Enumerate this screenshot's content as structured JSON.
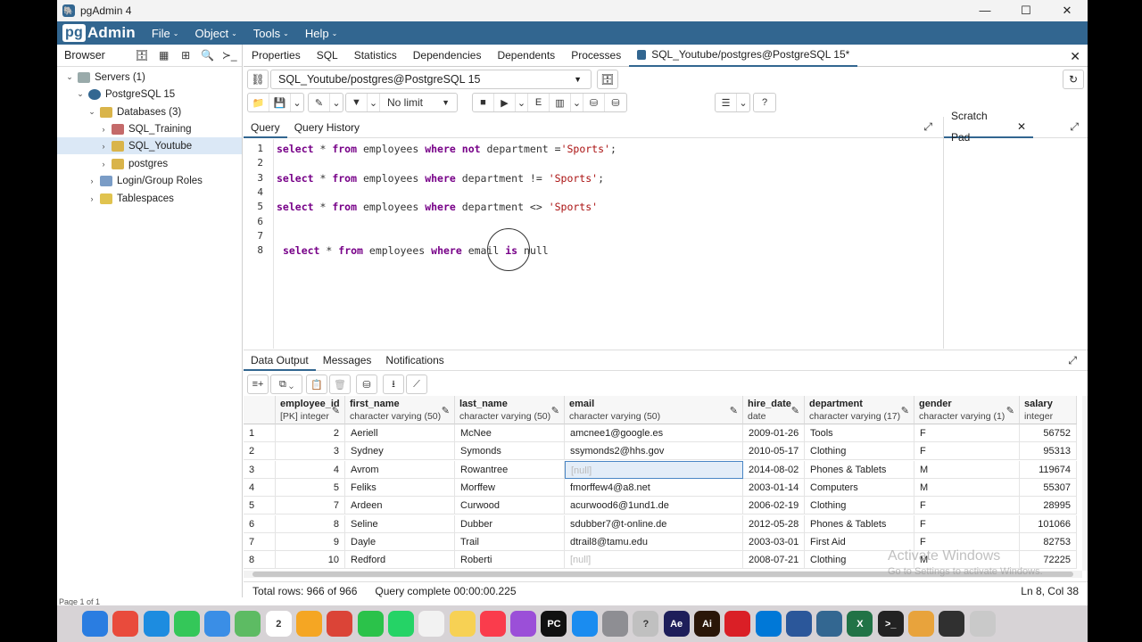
{
  "window": {
    "title": "pgAdmin 4",
    "btn_min": "—",
    "btn_max": "☐",
    "btn_close": "✕"
  },
  "menu": {
    "logo_pg": "pg",
    "logo_admin": "Admin",
    "items": [
      "File",
      "Object",
      "Tools",
      "Help"
    ]
  },
  "browser": {
    "title": "Browser",
    "tree": [
      {
        "label": "Servers (1)",
        "arrow": "⌄"
      },
      {
        "label": "PostgreSQL 15",
        "arrow": "⌄"
      },
      {
        "label": "Databases (3)",
        "arrow": "⌄"
      },
      {
        "label": "SQL_Training",
        "arrow": "›"
      },
      {
        "label": "SQL_Youtube",
        "arrow": "›"
      },
      {
        "label": "postgres",
        "arrow": "›"
      },
      {
        "label": "Login/Group Roles",
        "arrow": "›"
      },
      {
        "label": "Tablespaces",
        "arrow": "›"
      }
    ],
    "page_info": "Page 1 of 1"
  },
  "main_tabs": [
    "Properties",
    "SQL",
    "Statistics",
    "Dependencies",
    "Dependents",
    "Processes",
    "SQL_Youtube/postgres@PostgreSQL 15*"
  ],
  "connection": {
    "value": "SQL_Youtube/postgres@PostgreSQL 15"
  },
  "toolbar": {
    "limit": "No limit"
  },
  "query_tabs": [
    "Query",
    "Query History"
  ],
  "scratch": {
    "title": "Scratch Pad",
    "close": "✕"
  },
  "editor": {
    "line_numbers": [
      "1",
      "2",
      "3",
      "4",
      "5",
      "6",
      "7",
      "8"
    ],
    "lines": [
      [
        {
          "t": "select",
          "k": "kw"
        },
        {
          "t": " * ",
          "k": ""
        },
        {
          "t": "from",
          "k": "kw"
        },
        {
          "t": " employees ",
          "k": ""
        },
        {
          "t": "where",
          "k": "kw"
        },
        {
          "t": " ",
          "k": ""
        },
        {
          "t": "not",
          "k": "kw"
        },
        {
          "t": " department =",
          "k": ""
        },
        {
          "t": "'Sports'",
          "k": "str"
        },
        {
          "t": ";",
          "k": ""
        }
      ],
      [],
      [
        {
          "t": "select",
          "k": "kw"
        },
        {
          "t": " * ",
          "k": ""
        },
        {
          "t": "from",
          "k": "kw"
        },
        {
          "t": " employees ",
          "k": ""
        },
        {
          "t": "where",
          "k": "kw"
        },
        {
          "t": " department != ",
          "k": ""
        },
        {
          "t": "'Sports'",
          "k": "str"
        },
        {
          "t": ";",
          "k": ""
        }
      ],
      [],
      [
        {
          "t": "select",
          "k": "kw"
        },
        {
          "t": " * ",
          "k": ""
        },
        {
          "t": "from",
          "k": "kw"
        },
        {
          "t": " employees ",
          "k": ""
        },
        {
          "t": "where",
          "k": "kw"
        },
        {
          "t": " department <> ",
          "k": ""
        },
        {
          "t": "'Sports'",
          "k": "str"
        }
      ],
      [],
      [],
      [
        {
          "t": " ",
          "k": ""
        },
        {
          "t": "select",
          "k": "kw"
        },
        {
          "t": " * ",
          "k": ""
        },
        {
          "t": "from",
          "k": "kw"
        },
        {
          "t": " employees ",
          "k": ""
        },
        {
          "t": "where",
          "k": "kw"
        },
        {
          "t": " email ",
          "k": ""
        },
        {
          "t": "is",
          "k": "kw"
        },
        {
          "t": " null",
          "k": ""
        }
      ]
    ]
  },
  "output_tabs": [
    "Data Output",
    "Messages",
    "Notifications"
  ],
  "grid": {
    "columns": [
      {
        "name": "employee_id",
        "type": "[PK] integer"
      },
      {
        "name": "first_name",
        "type": "character varying (50)"
      },
      {
        "name": "last_name",
        "type": "character varying (50)"
      },
      {
        "name": "email",
        "type": "character varying (50)"
      },
      {
        "name": "hire_date",
        "type": "date"
      },
      {
        "name": "department",
        "type": "character varying (17)"
      },
      {
        "name": "gender",
        "type": "character varying (1)"
      },
      {
        "name": "salary",
        "type": "integer"
      }
    ],
    "rows": [
      [
        "1",
        "2",
        "Aeriell",
        "McNee",
        "amcnee1@google.es",
        "2009-01-26",
        "Tools",
        "F",
        "56752"
      ],
      [
        "2",
        "3",
        "Sydney",
        "Symonds",
        "ssymonds2@hhs.gov",
        "2010-05-17",
        "Clothing",
        "F",
        "95313"
      ],
      [
        "3",
        "4",
        "Avrom",
        "Rowantree",
        "[null]",
        "2014-08-02",
        "Phones & Tablets",
        "M",
        "119674"
      ],
      [
        "4",
        "5",
        "Feliks",
        "Morffew",
        "fmorffew4@a8.net",
        "2003-01-14",
        "Computers",
        "M",
        "55307"
      ],
      [
        "5",
        "7",
        "Ardeen",
        "Curwood",
        "acurwood6@1und1.de",
        "2006-02-19",
        "Clothing",
        "F",
        "28995"
      ],
      [
        "6",
        "8",
        "Seline",
        "Dubber",
        "sdubber7@t-online.de",
        "2012-05-28",
        "Phones & Tablets",
        "F",
        "101066"
      ],
      [
        "7",
        "9",
        "Dayle",
        "Trail",
        "dtrail8@tamu.edu",
        "2003-03-01",
        "First Aid",
        "F",
        "82753"
      ],
      [
        "8",
        "10",
        "Redford",
        "Roberti",
        "[null]",
        "2008-07-21",
        "Clothing",
        "M",
        "72225"
      ]
    ]
  },
  "status": {
    "rows": "Total rows: 966 of 966",
    "query": "Query complete 00:00:00.225",
    "position": "Ln 8, Col 38"
  },
  "watermark": {
    "line1": "Activate Windows",
    "line2": "Go to Settings to activate Windows."
  },
  "dock": [
    {
      "icon": "finder-icon",
      "color": "#2a7de1",
      "label": ""
    },
    {
      "icon": "launchpad-icon",
      "color": "#e94b3c",
      "label": ""
    },
    {
      "icon": "safari-icon",
      "color": "#1d8ce0",
      "label": ""
    },
    {
      "icon": "messages-icon",
      "color": "#34c759",
      "label": ""
    },
    {
      "icon": "mail-icon",
      "color": "#3a8ee6",
      "label": ""
    },
    {
      "icon": "maps-icon",
      "color": "#5dbb63",
      "label": ""
    },
    {
      "icon": "calendar-icon",
      "color": "#ffffff",
      "label": "2"
    },
    {
      "icon": "photos-icon",
      "color": "#f5a623",
      "label": ""
    },
    {
      "icon": "chrome-icon",
      "color": "#db4437",
      "label": ""
    },
    {
      "icon": "facetime-icon",
      "color": "#2bc24a",
      "label": ""
    },
    {
      "icon": "whatsapp-icon",
      "color": "#25d366",
      "label": ""
    },
    {
      "icon": "reminders-icon",
      "color": "#f2f2f2",
      "label": ""
    },
    {
      "icon": "notes-icon",
      "color": "#f7d154",
      "label": ""
    },
    {
      "icon": "music-icon",
      "color": "#fa3c4c",
      "label": ""
    },
    {
      "icon": "podcasts-icon",
      "color": "#9b4fd8",
      "label": ""
    },
    {
      "icon": "pycharm-icon",
      "color": "#111111",
      "label": "PC"
    },
    {
      "icon": "appstore-icon",
      "color": "#1a8cf0",
      "label": ""
    },
    {
      "icon": "settings-icon",
      "color": "#8e8e93",
      "label": ""
    },
    {
      "icon": "help-icon",
      "color": "#c0c0c0",
      "label": "?"
    },
    {
      "icon": "aftereffects-icon",
      "color": "#1e1e5a",
      "label": "Ae"
    },
    {
      "icon": "illustrator-icon",
      "color": "#2a1608",
      "label": "Ai"
    },
    {
      "icon": "creativecloud-icon",
      "color": "#da1f26",
      "label": ""
    },
    {
      "icon": "windows-icon",
      "color": "#0078d7",
      "label": ""
    },
    {
      "icon": "word-icon",
      "color": "#2b579a",
      "label": ""
    },
    {
      "icon": "pgadmin-icon",
      "color": "#336791",
      "label": ""
    },
    {
      "icon": "excel-icon",
      "color": "#217346",
      "label": "X"
    },
    {
      "icon": "terminal-icon",
      "color": "#222222",
      "label": ">_"
    },
    {
      "icon": "stats-icon",
      "color": "#e8a33c",
      "label": ""
    },
    {
      "icon": "quicktime-icon",
      "color": "#303030",
      "label": ""
    },
    {
      "icon": "trash-icon",
      "color": "#c9c9c9",
      "label": ""
    }
  ]
}
